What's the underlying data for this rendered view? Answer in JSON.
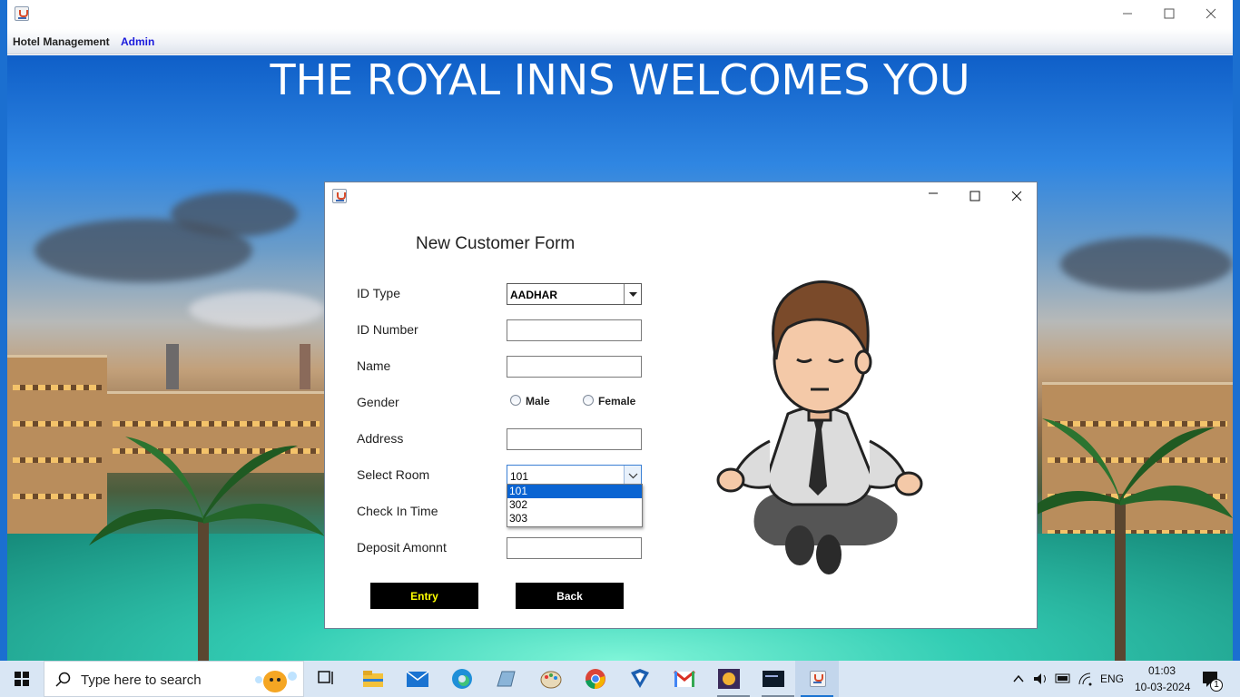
{
  "main_window": {
    "menu": [
      "Hotel Management",
      "Admin"
    ]
  },
  "welcome_text": "THE ROYAL INNS WELCOMES YOU",
  "dialog": {
    "title": "New Customer Form",
    "labels": {
      "id_type": "ID Type",
      "id_number": "ID Number",
      "name": "Name",
      "gender": "Gender",
      "address": "Address",
      "select_room": "Select Room",
      "check_in_time": "Check In Time",
      "deposit_amount": "Deposit Amonnt"
    },
    "id_type_value": "AADHAR",
    "gender_options": [
      "Male",
      "Female"
    ],
    "room_selected": "101",
    "room_options": [
      "101",
      "302",
      "303"
    ],
    "buttons": {
      "entry": "Entry",
      "back": "Back"
    },
    "colors": {
      "entry_text": "#ffff00",
      "back_text": "#ffffff",
      "button_bg": "#000000"
    }
  },
  "taskbar": {
    "search_placeholder": "Type here to search",
    "tray": {
      "language": "ENG",
      "time": "01:03",
      "date": "10-03-2024",
      "notifications": "1"
    },
    "pinned": [
      "task-view-icon",
      "file-explorer-icon",
      "mail-icon",
      "edge-icon",
      "app-icon",
      "paint-icon",
      "chrome-icon",
      "vpn-icon",
      "gmail-icon",
      "game-icon",
      "mysql-icon",
      "java-icon"
    ]
  }
}
